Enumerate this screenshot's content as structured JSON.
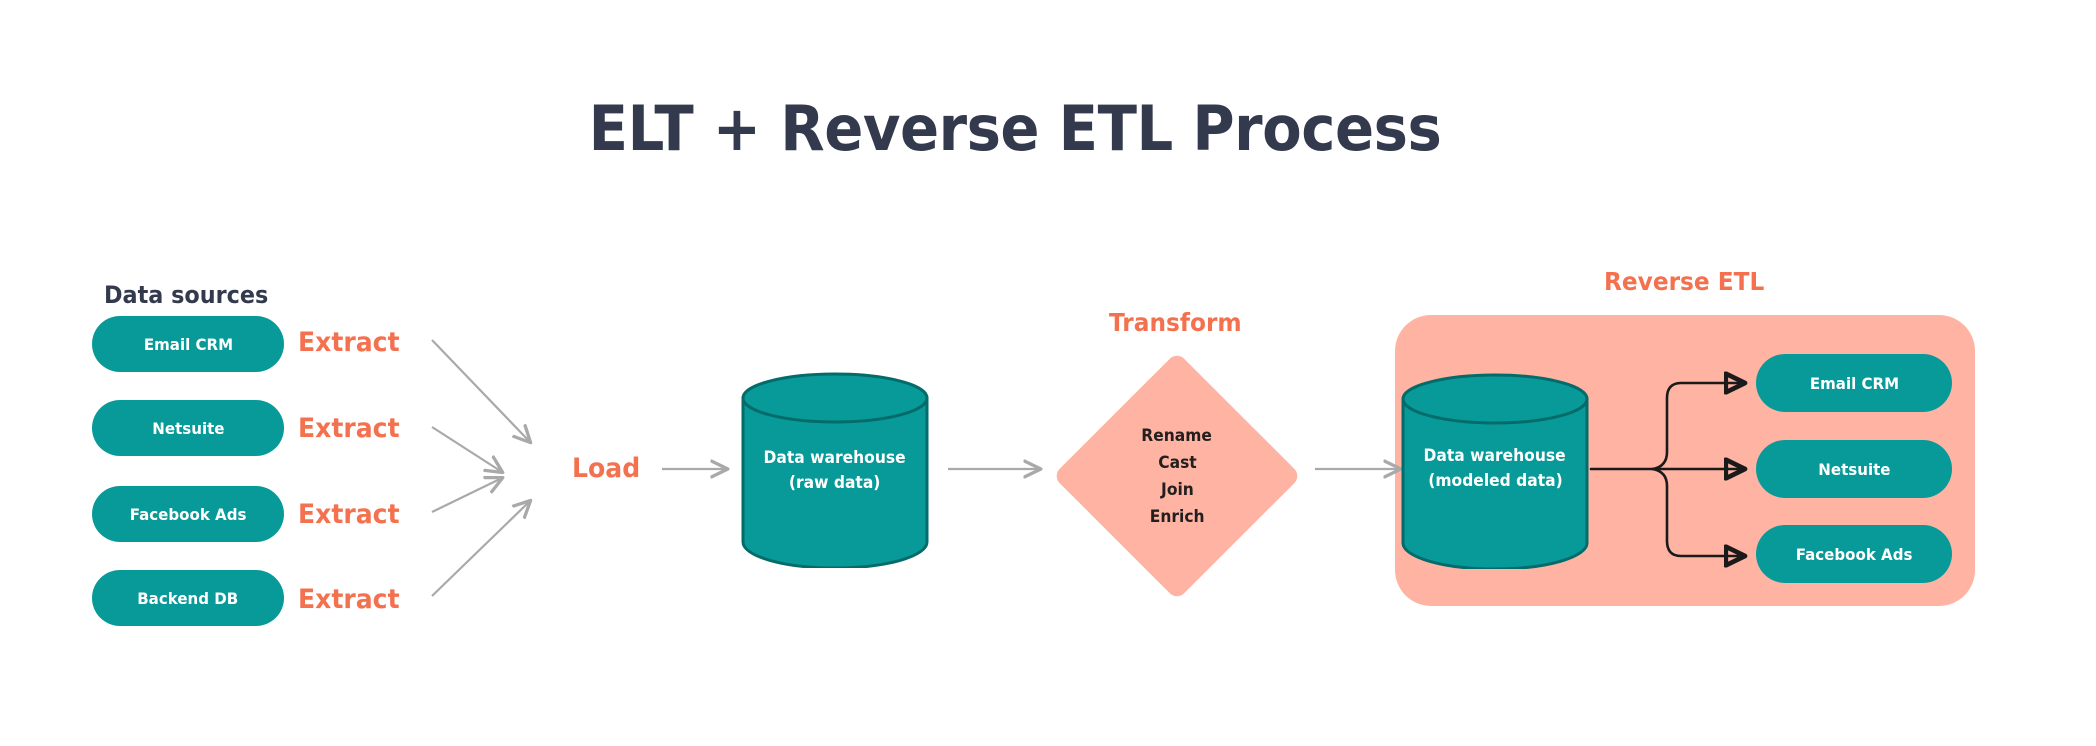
{
  "title": "ELT + Reverse ETL Process",
  "colors": {
    "teal": "#089a99",
    "teal_dark": "#046b6b",
    "salmon": "#ffb3a3",
    "orange": "#f4714f",
    "navy": "#343a4d",
    "arrow_gray": "#a9a9a9",
    "arrow_black": "#1a1a1a",
    "background": "#ffffff"
  },
  "sections": {
    "data_sources_label": "Data sources",
    "transform_label": "Transform",
    "reverse_etl_label": "Reverse ETL",
    "load_label": "Load"
  },
  "data_sources": [
    {
      "name": "Email CRM",
      "action": "Extract"
    },
    {
      "name": "Netsuite",
      "action": "Extract"
    },
    {
      "name": "Facebook Ads",
      "action": "Extract"
    },
    {
      "name": "Backend DB",
      "action": "Extract"
    }
  ],
  "warehouses": {
    "raw": {
      "line1": "Data warehouse",
      "line2": "(raw data)"
    },
    "modeled": {
      "line1": "Data warehouse",
      "line2": "(modeled data)"
    }
  },
  "transform_operations": [
    "Rename",
    "Cast",
    "Join",
    "Enrich"
  ],
  "destinations": [
    {
      "name": "Email CRM"
    },
    {
      "name": "Netsuite"
    },
    {
      "name": "Facebook Ads"
    }
  ],
  "chart_data": {
    "type": "diagram",
    "title": "ELT + Reverse ETL Process",
    "flow_stages": [
      {
        "stage": "Data sources",
        "items": [
          "Email CRM",
          "Netsuite",
          "Facebook Ads",
          "Backend DB"
        ],
        "edge_label": "Extract"
      },
      {
        "stage": "Load",
        "items": [],
        "edge_label": "Load"
      },
      {
        "stage": "Data warehouse (raw data)",
        "items": []
      },
      {
        "stage": "Transform",
        "items": [
          "Rename",
          "Cast",
          "Join",
          "Enrich"
        ],
        "edge_label": "Transform"
      },
      {
        "stage": "Data warehouse (modeled data)",
        "items": []
      },
      {
        "stage": "Reverse ETL",
        "items": [
          "Email CRM",
          "Netsuite",
          "Facebook Ads"
        ],
        "edge_label": "Reverse ETL"
      }
    ]
  }
}
